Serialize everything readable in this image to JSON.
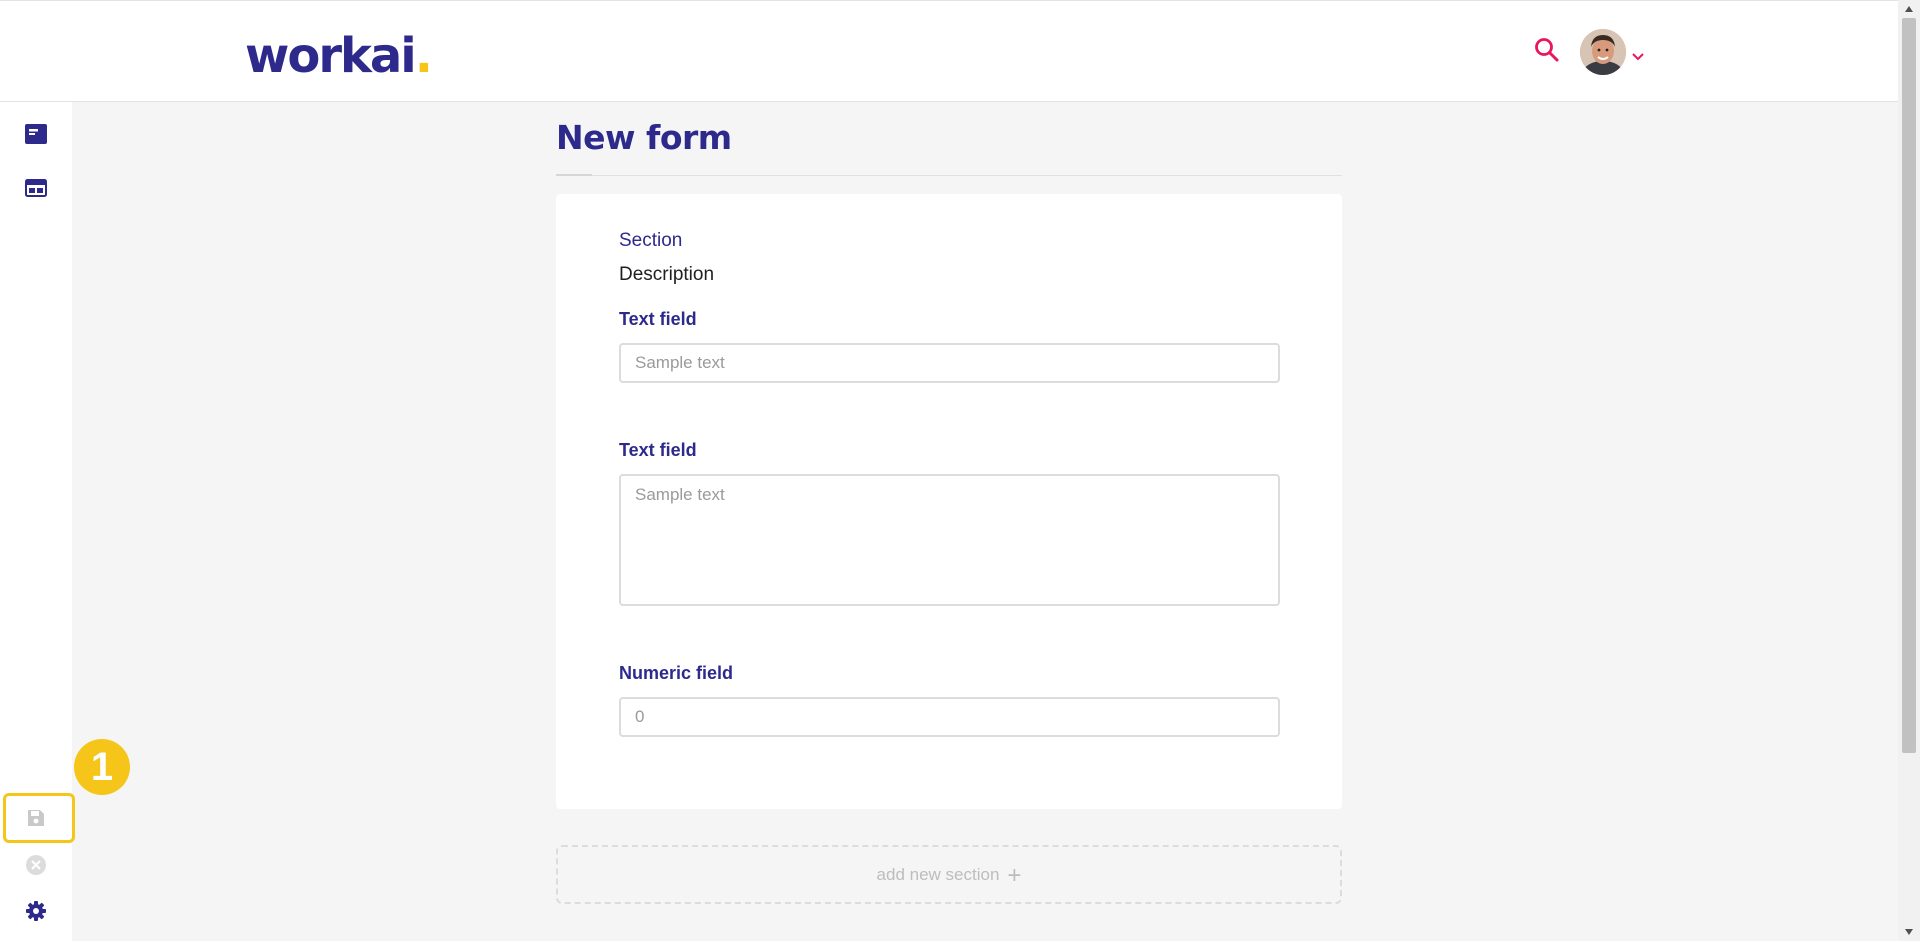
{
  "header": {
    "logo_text": "workai",
    "logo_dot": ".",
    "accent_color": "#e8175d",
    "brand_color": "#2d2a8c"
  },
  "sidebar": {
    "items": [
      {
        "name": "view-icon"
      },
      {
        "name": "layout-icon"
      },
      {
        "name": "save-icon"
      },
      {
        "name": "close-icon"
      },
      {
        "name": "gear-icon"
      }
    ]
  },
  "annotation": {
    "step": "1",
    "highlight_color": "#f6c519"
  },
  "main": {
    "title": "New form",
    "section": {
      "label": "Section",
      "description": "Description"
    },
    "fields": [
      {
        "label": "Text field",
        "placeholder": "Sample text"
      },
      {
        "label": "Text field",
        "placeholder": "Sample text"
      },
      {
        "label": "Numeric field",
        "placeholder": "0"
      }
    ],
    "add_section_label": "add new section",
    "add_section_plus": "+"
  }
}
